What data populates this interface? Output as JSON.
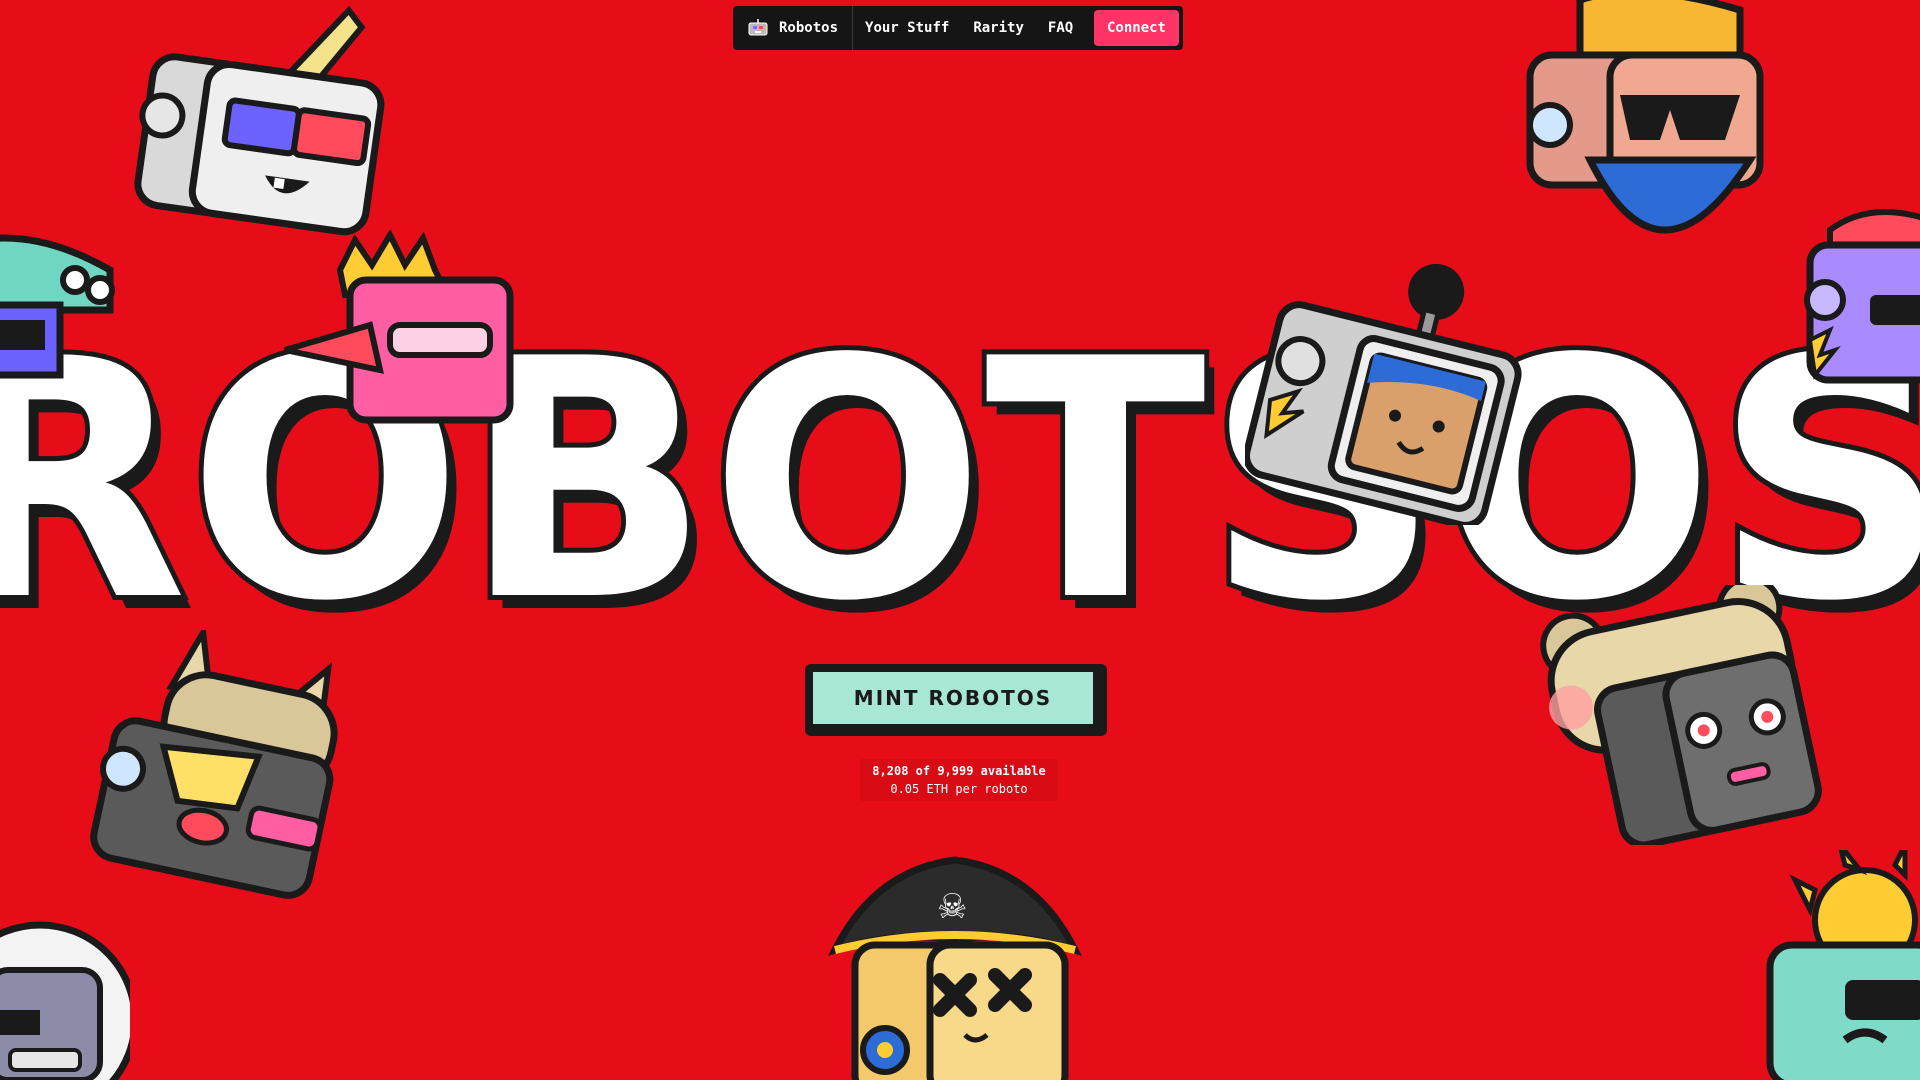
{
  "nav": {
    "brand_label": "Robotos",
    "items": [
      "Your Stuff",
      "Rarity",
      "FAQ"
    ],
    "connect_label": "Connect"
  },
  "hero": {
    "title_text": "ROBOTSOS"
  },
  "mint": {
    "button_label": "MINT ROBOTOS",
    "availability": "8,208 of 9,999 available",
    "price": "0.05 ETH per roboto"
  },
  "colors": {
    "background": "#E60D19",
    "nav_bg": "#151515",
    "connect_bg": "#FF3366",
    "mint_bg": "#A8E6D5",
    "outline": "#1a1a1a"
  },
  "icons": [
    "robot-logo-icon"
  ]
}
